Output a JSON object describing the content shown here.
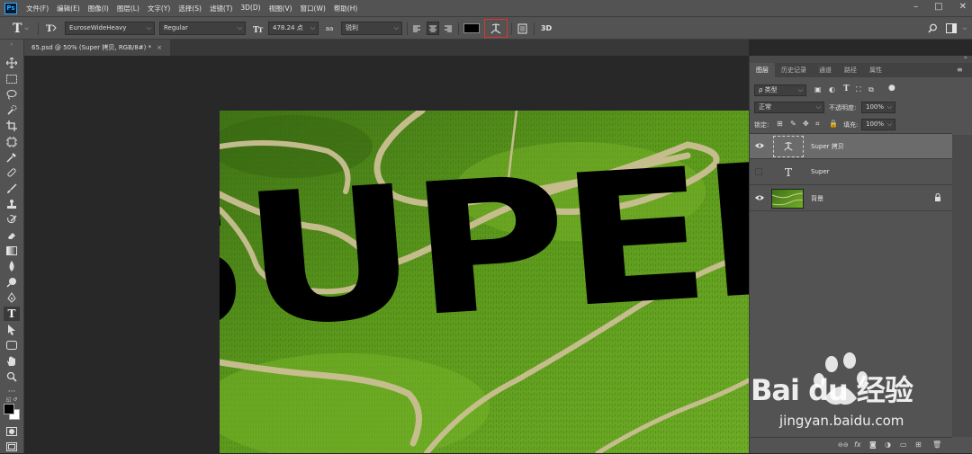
{
  "app": {
    "logo": "Ps"
  },
  "menu": [
    "文件(F)",
    "编辑(E)",
    "图像(I)",
    "图层(L)",
    "文字(Y)",
    "选择(S)",
    "滤镜(T)",
    "3D(D)",
    "视图(V)",
    "窗口(W)",
    "帮助(H)"
  ],
  "options": {
    "font_family": "EuroseWideHeavy",
    "font_style": "Regular",
    "font_size": "478.24 点",
    "aa_label": "aa",
    "antialias": "锐利",
    "threed_label": "3D",
    "text_color": "#000000"
  },
  "document_tab": {
    "title": "65.psd @ 50% (Super 拷贝, RGB/8#) *",
    "close": "×"
  },
  "canvas": {
    "warped_text": "SUPER"
  },
  "layers_panel": {
    "tabs": [
      "图层",
      "历史记录",
      "通道",
      "路径",
      "属性"
    ],
    "active_tab": "图层",
    "filter_label": "ρ 类型",
    "blend_mode": "正常",
    "opacity_label": "不透明度:",
    "opacity_value": "100%",
    "lock_label": "锁定:",
    "fill_label": "填充:",
    "fill_value": "100%",
    "layers": [
      {
        "name": "Super 拷贝",
        "type": "warped-text",
        "visible": true,
        "selected": true
      },
      {
        "name": "Super",
        "type": "text",
        "visible": false,
        "selected": false
      },
      {
        "name": "背景",
        "type": "image",
        "visible": true,
        "selected": false,
        "locked": true
      }
    ]
  },
  "watermark": {
    "brand": "Bai du 经验",
    "url": "jingyan.baidu.com"
  }
}
